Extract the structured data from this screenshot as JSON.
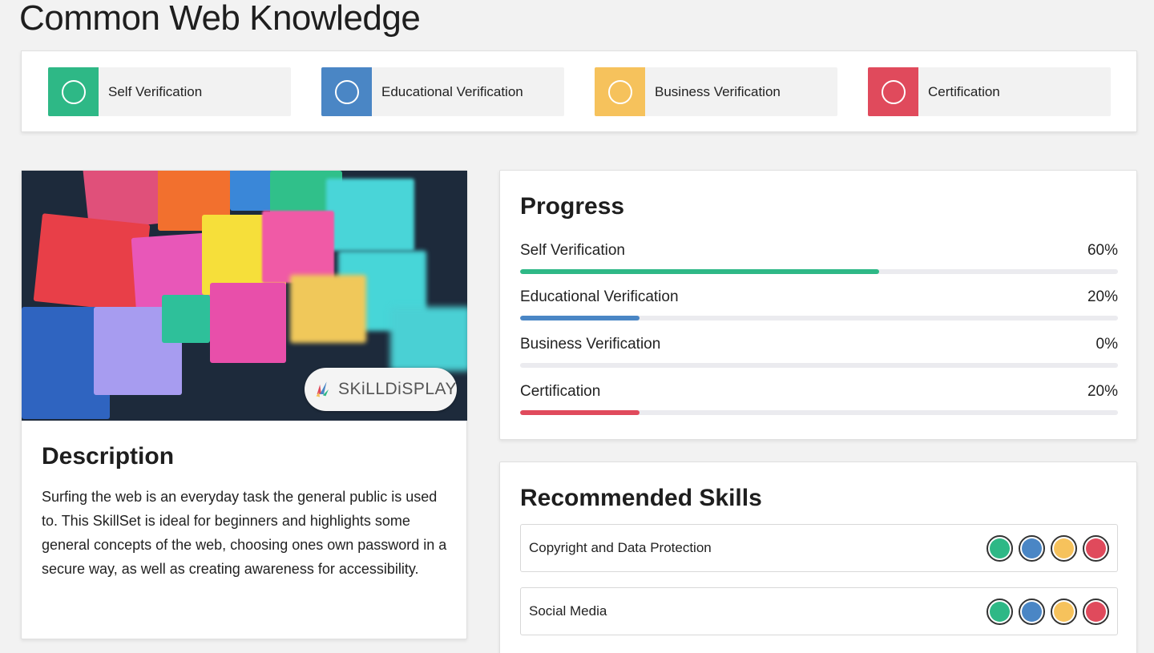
{
  "page": {
    "title": "Common Web Knowledge"
  },
  "colors": {
    "self": "#2eb886",
    "educational": "#4a86c5",
    "business": "#f6c25c",
    "certification": "#e04a5c"
  },
  "verification_bar": {
    "items": [
      {
        "label": "Self Verification",
        "color": "#2eb886",
        "icon": "circle-outline-icon"
      },
      {
        "label": "Educational Verification",
        "color": "#4a86c5",
        "icon": "circle-outline-icon"
      },
      {
        "label": "Business Verification",
        "color": "#f6c25c",
        "icon": "circle-outline-icon"
      },
      {
        "label": "Certification",
        "color": "#e04a5c",
        "icon": "circle-outline-icon"
      }
    ]
  },
  "description_card": {
    "logo_text": "SKiLLDiSPLAY",
    "title": "Description",
    "body": "Surfing the web is an everyday task the general public is used to. This SkillSet is ideal for beginners and highlights some general concepts of the web, choosing ones own password in a secure way, as well as creating awareness for accessibility."
  },
  "progress": {
    "title": "Progress",
    "items": [
      {
        "label": "Self Verification",
        "value": "60%",
        "fraction": 0.6,
        "color": "#2eb886"
      },
      {
        "label": "Educational Verification",
        "value": "20%",
        "fraction": 0.2,
        "color": "#4a86c5"
      },
      {
        "label": "Business Verification",
        "value": "0%",
        "fraction": 0.0,
        "color": "#f6c25c"
      },
      {
        "label": "Certification",
        "value": "20%",
        "fraction": 0.2,
        "color": "#e04a5c"
      }
    ]
  },
  "recommended": {
    "title": "Recommended Skills",
    "items": [
      {
        "name": "Copyright and Data Protection"
      },
      {
        "name": "Social Media"
      }
    ]
  }
}
